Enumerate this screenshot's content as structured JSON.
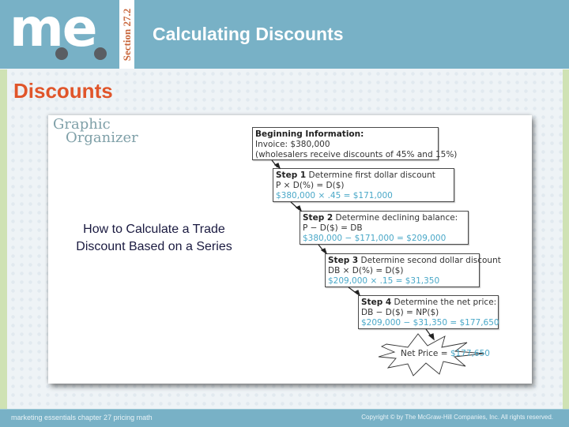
{
  "header": {
    "logo_text": "me",
    "section_label": "Section 27.2",
    "title": "Calculating Discounts"
  },
  "slide": {
    "heading": "Discounts"
  },
  "organizer": {
    "label_line1": "Graphic",
    "label_line2": "Organizer",
    "caption": "How to Calculate a Trade Discount Based on a Series",
    "beginning": {
      "title": "Beginning Information:",
      "line1": "Invoice: $380,000",
      "line2": "(wholesalers receive discounts of 45% and 15%)"
    },
    "steps": [
      {
        "label": "Step 1",
        "text": "Determine first dollar discount",
        "formula": "P × D(%) = D($)",
        "calc": "$380,000 × .45 = $171,000"
      },
      {
        "label": "Step 2",
        "text": "Determine declining balance:",
        "formula": "P − D($) = DB",
        "calc": "$380,000 − $171,000 = $209,000"
      },
      {
        "label": "Step 3",
        "text": "Determine second dollar discount",
        "formula": "DB × D(%) = D($)",
        "calc": "$209,000 × .15 = $31,350"
      },
      {
        "label": "Step 4",
        "text": "Determine the net price:",
        "formula": "DB − D($) = NP($)",
        "calc": "$209,000 − $31,350 = $177,650"
      }
    ],
    "result": {
      "label": "Net Price =",
      "value": "$177,650"
    }
  },
  "footer": {
    "left": "marketing essentials  chapter 27  pricing math",
    "right": "Copyright © by The McGraw-Hill Companies, Inc. All rights reserved."
  },
  "colors": {
    "header_bg": "#78b1c6",
    "heading": "#e0552a",
    "calc_text": "#4aa8c8",
    "section_label": "#c8653a"
  }
}
